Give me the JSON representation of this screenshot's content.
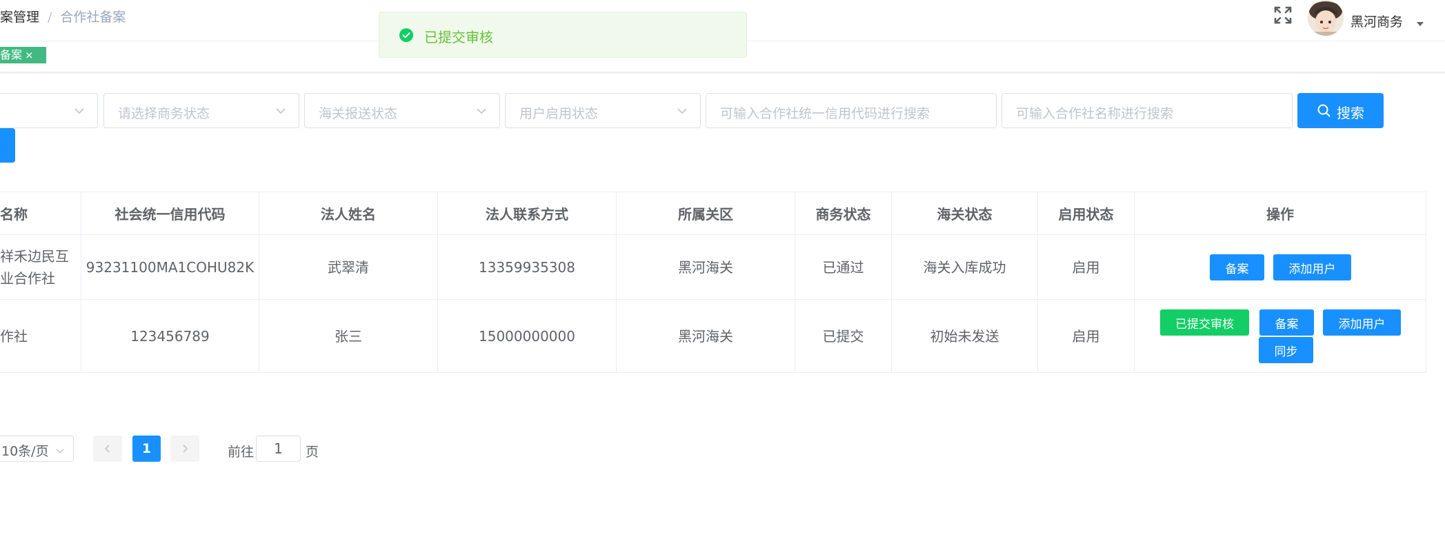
{
  "breadcrumb": {
    "first": "案管理",
    "separator": "/",
    "second": "合作社备案"
  },
  "header": {
    "username": "黑河商务"
  },
  "tags": [
    {
      "label": "备案",
      "close": "×"
    }
  ],
  "toast": {
    "message": "已提交审核"
  },
  "filters": {
    "select1_placeholder": "",
    "business_status_placeholder": "请选择商务状态",
    "customs_status_placeholder": "海关报送状态",
    "user_enabled_placeholder": "用户启用状态",
    "credit_code_placeholder": "可输入合作社统一信用代码进行搜索",
    "coop_name_placeholder": "可输入合作社名称进行搜索",
    "search_label": "搜索"
  },
  "table": {
    "headers": [
      "名称",
      "社会统一信用代码",
      "法人姓名",
      "法人联系方式",
      "所属关区",
      "商务状态",
      "海关状态",
      "启用状态",
      "操作"
    ],
    "rows": [
      {
        "name_line1": "祥禾边民互",
        "name_line2": "业合作社",
        "credit_code": "93231100MA1COHU82K",
        "legal_name": "武翠清",
        "phone": "13359935308",
        "customs_area": "黑河海关",
        "business_status": "已通过",
        "customs_status": "海关入库成功",
        "enabled": "启用",
        "actions": [
          "备案",
          "添加用户"
        ]
      },
      {
        "name_line1": "作社",
        "name_line2": "",
        "credit_code": "123456789",
        "legal_name": "张三",
        "phone": "15000000000",
        "customs_area": "黑河海关",
        "business_status": "已提交",
        "customs_status": "初始未发送",
        "enabled": "启用",
        "actions": [
          "已提交审核",
          "备案",
          "添加用户",
          "同步"
        ]
      }
    ]
  },
  "pagination": {
    "page_size": "10条/页",
    "current_page": "1",
    "goto_label": "前往",
    "goto_value": "1",
    "goto_unit": "页"
  },
  "colors": {
    "primary": "#1890ff",
    "success": "#13ce66",
    "tag": "#42b983",
    "toast_bg": "#f0f9eb",
    "toast_text": "#67c23a"
  }
}
